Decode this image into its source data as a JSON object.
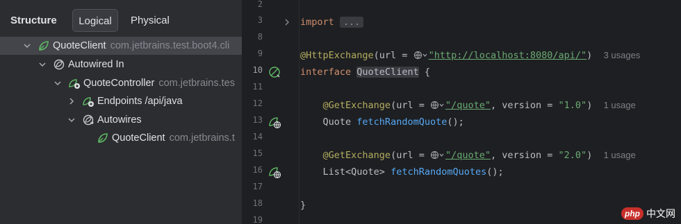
{
  "structure": {
    "title": "Structure",
    "tabs": {
      "logical": "Logical",
      "physical": "Physical"
    },
    "tree": [
      {
        "name": "QuoteClient",
        "extra": "com.jetbrains.test.boot4.cli",
        "icon": "spring-leaf-icon",
        "expanded": true,
        "selected": true
      },
      {
        "name": "Autowired In",
        "extra": "",
        "icon": "autowired-icon",
        "expanded": true
      },
      {
        "name": "QuoteController",
        "extra": "com.jetbrains.tes",
        "icon": "spring-bean-icon",
        "expanded": true
      },
      {
        "name": "Endpoints /api/java",
        "extra": "",
        "icon": "endpoints-icon",
        "expanded": false
      },
      {
        "name": "Autowires",
        "extra": "",
        "icon": "autowires-icon",
        "expanded": true
      },
      {
        "name": "QuoteClient",
        "extra": "com.jetbrains.t",
        "icon": "spring-leaf-icon",
        "expanded": null
      }
    ]
  },
  "editor": {
    "line_numbers": [
      "2",
      "3",
      "8",
      "9",
      "10",
      "11",
      "12",
      "13",
      "14",
      "15",
      "16",
      "17",
      "18",
      "19"
    ],
    "current_line": "10",
    "code": {
      "import_kw": "import",
      "import_fold": "...",
      "http_exchange": "@HttpExchange",
      "url_open": "(url = ",
      "base_url": "\"http://localhost:8080/api/\"",
      "paren_close": ")",
      "usages_3": "3 usages",
      "interface_kw": "interface",
      "interface_name": "QuoteClient",
      "brace_open": " {",
      "get_exchange": "@GetExchange",
      "quote_path": "\"/quote\"",
      "version_label": ", version = ",
      "version_1": "\"1.0\"",
      "version_2": "\"2.0\"",
      "usage_1": "1 usage",
      "quote_type": "Quote ",
      "method_single": "fetchRandomQuote",
      "call_end": "();",
      "list_type": "List<Quote> ",
      "method_multi": "fetchRandomQuotes",
      "brace_close": "}"
    }
  },
  "watermark": {
    "badge": "php",
    "text": "中文网"
  },
  "colors": {
    "spring_green": "#5fb865",
    "keyword": "#cf8e6d",
    "annotation": "#b3ae60",
    "string": "#6aab73",
    "function": "#56a8f5"
  }
}
